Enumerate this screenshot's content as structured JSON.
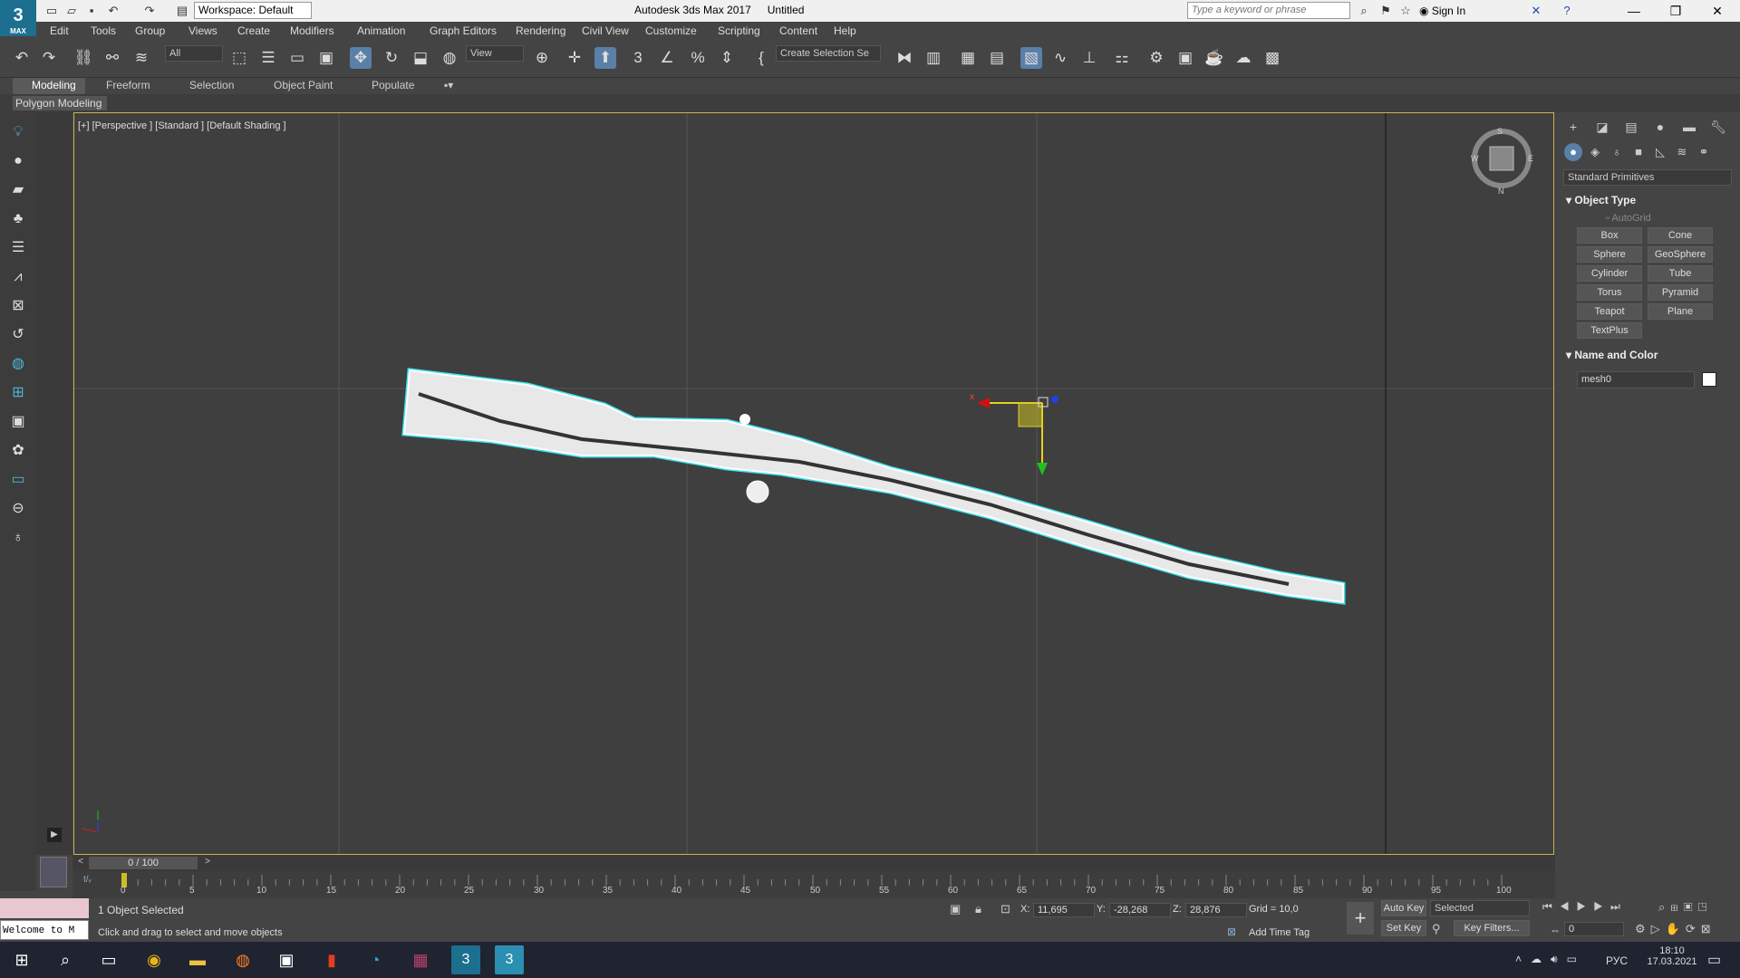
{
  "app": {
    "logo_text": "3",
    "logo_sub": "MAX",
    "title": "Autodesk 3ds Max 2017",
    "document": "Untitled",
    "workspace": "Workspace: Default",
    "search_placeholder": "Type a keyword or phrase",
    "sign_in": "Sign In"
  },
  "menu": [
    "Edit",
    "Tools",
    "Group",
    "Views",
    "Create",
    "Modifiers",
    "Animation",
    "Graph Editors",
    "Rendering",
    "Civil View",
    "Customize",
    "Scripting",
    "Content",
    "Help"
  ],
  "toolbar": {
    "selection_filter": "All",
    "ref_coord": "View",
    "selection_set": "Create Selection Se"
  },
  "ribbon": {
    "tabs": [
      "Modeling",
      "Freeform",
      "Selection",
      "Object Paint",
      "Populate"
    ],
    "panel": "Polygon Modeling"
  },
  "viewport": {
    "label": "[+] [Perspective ] [Standard ] [Default Shading ]",
    "viewcube_letters": [
      "S",
      "E",
      "W",
      "N"
    ],
    "gizmo_x": "x"
  },
  "command_panel": {
    "category": "Standard Primitives",
    "object_type_title": "Object Type",
    "autogrid": "AutoGrid",
    "primitives": [
      "Box",
      "Cone",
      "Sphere",
      "GeoSphere",
      "Cylinder",
      "Tube",
      "Torus",
      "Pyramid",
      "Teapot",
      "Plane",
      "TextPlus"
    ],
    "name_color_title": "Name and Color",
    "object_name": "mesh0",
    "object_color": "#ffffff"
  },
  "timeline": {
    "frame": "0 / 100",
    "ticks": [
      "0",
      "5",
      "10",
      "15",
      "20",
      "25",
      "30",
      "35",
      "40",
      "45",
      "50",
      "55",
      "60",
      "65",
      "70",
      "75",
      "80",
      "85",
      "90",
      "95",
      "100"
    ]
  },
  "status": {
    "welcome": "Welcome to M",
    "selected": "1 Object Selected",
    "prompt": "Click and drag to select and move objects",
    "x_label": "X:",
    "x_value": "11,695",
    "y_label": "Y:",
    "y_value": "-28,268",
    "z_label": "Z:",
    "z_value": "28,876",
    "grid": "Grid = 10,0",
    "add_time_tag": "Add Time Tag",
    "auto_key": "Auto Key",
    "set_key": "Set Key",
    "key_mode": "Selected",
    "key_filters": "Key Filters...",
    "current_frame": "0"
  },
  "taskbar": {
    "lang": "РУС",
    "time": "18:10",
    "date": "17.03.2021"
  },
  "colors": {
    "viewport_border": "#c8b450",
    "selection_outline": "#30e0e8",
    "accent": "#1c6f8f"
  }
}
